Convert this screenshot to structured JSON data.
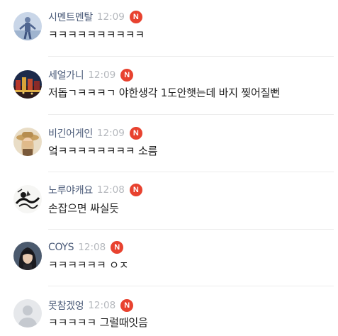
{
  "comments": [
    {
      "nickname": "시멘트멘탈",
      "time": "12:09",
      "badge": "N",
      "text": "ㅋㅋㅋㅋㅋㅋㅋㅋㅋㅋ",
      "avatar": "figure-avatar"
    },
    {
      "nickname": "세얼가니",
      "time": "12:09",
      "badge": "N",
      "text": "저돕ㄱㅋㅋㅋㄱ  야한생각 1도안햇는데 바지 찢어질뻔",
      "avatar": "cityscape-avatar"
    },
    {
      "nickname": "비긴어게인",
      "time": "12:09",
      "badge": "N",
      "text": "엌ㅋㅋㅋㅋㅋㅋㅋㅋ 소름",
      "avatar": "hat-person-avatar"
    },
    {
      "nickname": "노루야캐요",
      "time": "12:08",
      "badge": "N",
      "text": "손잡으면 싸실듯",
      "avatar": "ink-drawing-avatar"
    },
    {
      "nickname": "COYS",
      "time": "12:08",
      "badge": "N",
      "text": "ㅋㅋㅋㅋㅋㅋ ㅇㅈ",
      "avatar": "dark-hair-avatar"
    },
    {
      "nickname": "못참겠엉",
      "time": "12:08",
      "badge": "N",
      "text": "ㅋㅋㅋㅋㅋ 그럴때잇음",
      "avatar": "default-profile-avatar"
    }
  ],
  "colors": {
    "badge": "#e8422f",
    "nickname": "#4a5a78",
    "time": "#b5b8bd",
    "text": "#222222",
    "divider": "#ececec"
  }
}
